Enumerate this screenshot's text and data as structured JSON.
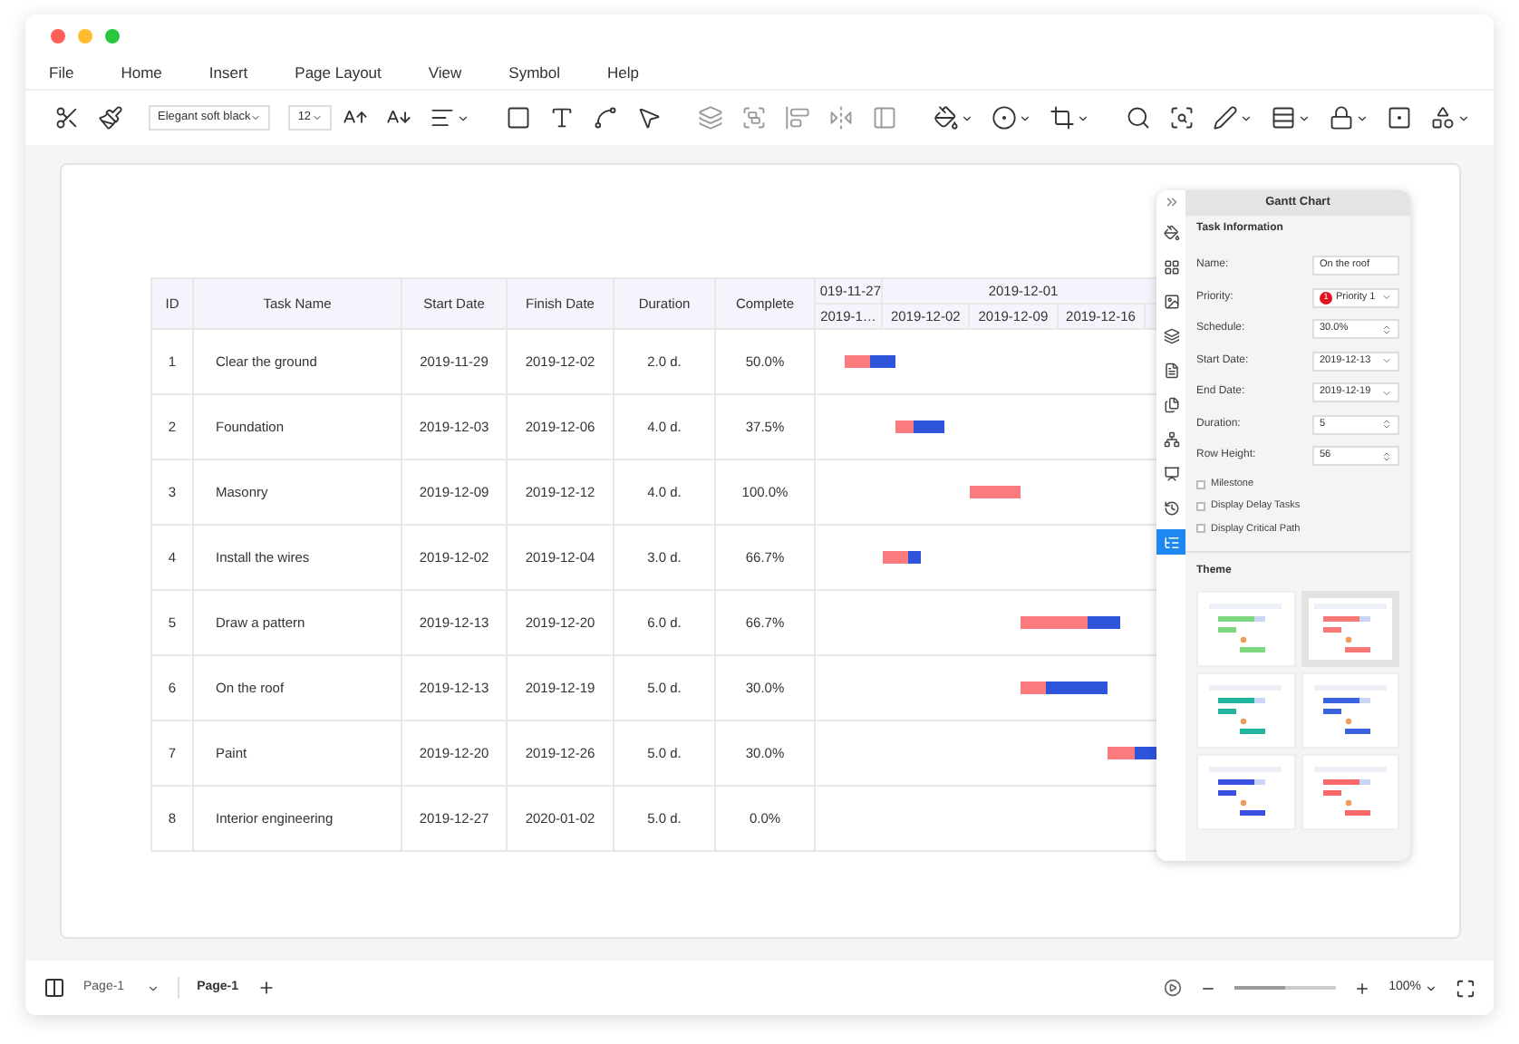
{
  "menu": [
    "File",
    "Home",
    "Insert",
    "Page Layout",
    "View",
    "Symbol",
    "Help"
  ],
  "toolbar": {
    "font": "Elegant soft black",
    "size": "12"
  },
  "table": {
    "columns": [
      "ID",
      "Task Name",
      "Start Date",
      "Finish Date",
      "Duration",
      "Complete"
    ],
    "rows": [
      {
        "id": "1",
        "name": "Clear the ground",
        "start": "2019-11-29",
        "finish": "2019-12-02",
        "duration": "2.0 d.",
        "complete": "50.0%"
      },
      {
        "id": "2",
        "name": "Foundation",
        "start": "2019-12-03",
        "finish": "2019-12-06",
        "duration": "4.0 d.",
        "complete": "37.5%"
      },
      {
        "id": "3",
        "name": "Masonry",
        "start": "2019-12-09",
        "finish": "2019-12-12",
        "duration": "4.0 d.",
        "complete": "100.0%"
      },
      {
        "id": "4",
        "name": "Install the wires",
        "start": "2019-12-02",
        "finish": "2019-12-04",
        "duration": "3.0 d.",
        "complete": "66.7%"
      },
      {
        "id": "5",
        "name": "Draw a pattern",
        "start": "2019-12-13",
        "finish": "2019-12-20",
        "duration": "6.0 d.",
        "complete": "66.7%"
      },
      {
        "id": "6",
        "name": "On the roof",
        "start": "2019-12-13",
        "finish": "2019-12-19",
        "duration": "5.0 d.",
        "complete": "30.0%"
      },
      {
        "id": "7",
        "name": "Paint",
        "start": "2019-12-20",
        "finish": "2019-12-26",
        "duration": "5.0 d.",
        "complete": "30.0%"
      },
      {
        "id": "8",
        "name": "Interior engineering",
        "start": "2019-12-27",
        "finish": "2020-01-02",
        "duration": "5.0 d.",
        "complete": "0.0%"
      }
    ]
  },
  "timeline": {
    "months": [
      "019-11-27",
      "2019-12-01"
    ],
    "weeks": [
      "2019-1…",
      "2019-12-02",
      "2019-12-09",
      "2019-12-16"
    ]
  },
  "panel": {
    "title": "Gantt Chart",
    "section": "Task Information",
    "tabs": [
      {
        "selected": false
      },
      {
        "selected": false
      },
      {
        "selected": false
      },
      {
        "selected": false
      },
      {
        "selected": false
      },
      {
        "selected": false
      },
      {
        "selected": false
      },
      {
        "selected": false
      },
      {
        "selected": false
      },
      {
        "selected": true
      }
    ],
    "fields": [
      {
        "label": "Name:",
        "value": "On the roof",
        "kind": "text"
      },
      {
        "label": "Priority:",
        "value": "Priority 1",
        "badge": "1",
        "kind": "dropdown"
      },
      {
        "label": "Schedule:",
        "value": "30.0%",
        "kind": "spin"
      },
      {
        "label": "Start Date:",
        "value": "2019-12-13",
        "kind": "dropdown"
      },
      {
        "label": "End Date:",
        "value": "2019-12-19",
        "kind": "dropdown"
      },
      {
        "label": "Duration:",
        "value": "5",
        "kind": "spin"
      },
      {
        "label": "Row Height:",
        "value": "56",
        "kind": "spin"
      }
    ],
    "checks": [
      {
        "label": "Milestone",
        "checked": false
      },
      {
        "label": "Display Delay Tasks",
        "checked": false
      },
      {
        "label": "Display Critical Path",
        "checked": false
      }
    ],
    "theme_title": "Theme",
    "themes": [
      {
        "color": "#7ed67e",
        "selected": false
      },
      {
        "color": "#f87878",
        "selected": true
      },
      {
        "color": "#22b5a0",
        "selected": false
      },
      {
        "color": "#3b63e0",
        "selected": false
      },
      {
        "color": "#3b4fe0",
        "selected": false
      },
      {
        "color": "#f86868",
        "selected": false
      }
    ]
  },
  "statusbar": {
    "page_select": "Page-1",
    "page_tab": "Page-1",
    "zoom": "100%",
    "level": 0.5
  }
}
